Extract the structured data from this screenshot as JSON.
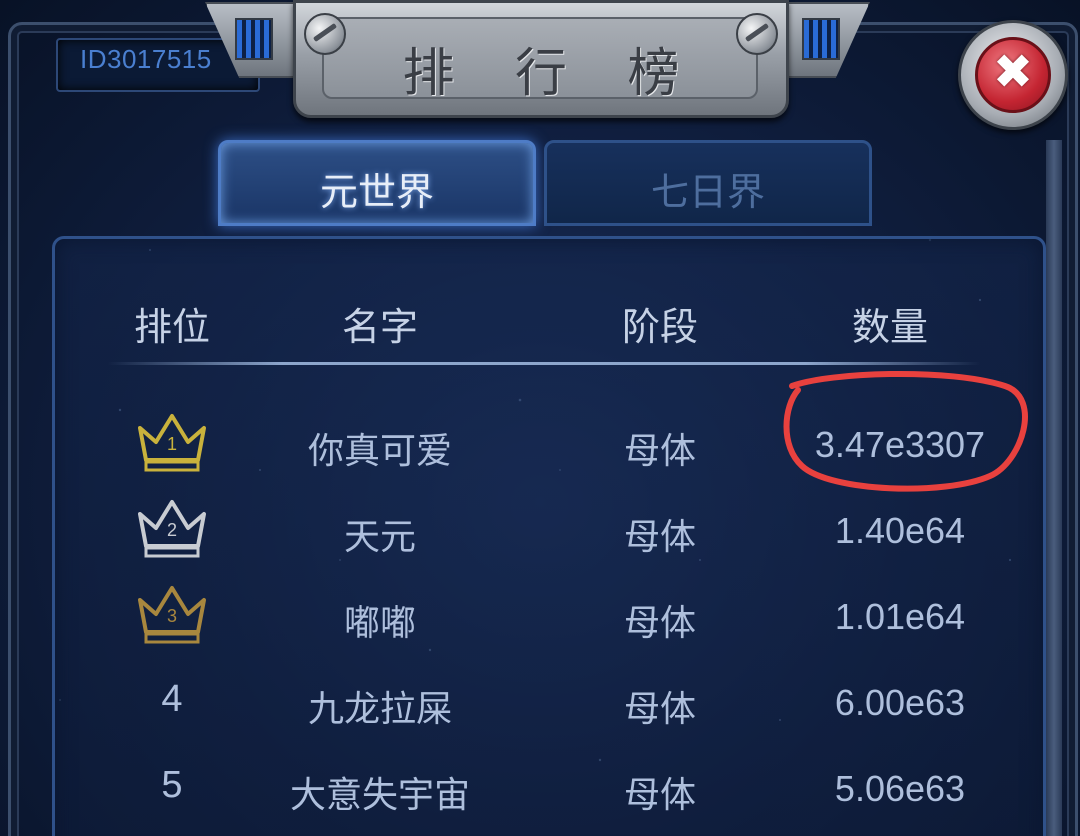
{
  "player_id": "ID3017515",
  "title": "排 行 榜",
  "close_symbol": "✖",
  "tabs": [
    {
      "label": "元世界",
      "active": true
    },
    {
      "label": "七日界",
      "active": false
    }
  ],
  "table": {
    "headers": {
      "rank": "排位",
      "name": "名字",
      "stage": "阶段",
      "amount": "数量"
    },
    "rows": [
      {
        "rank": "1",
        "crown": "gold",
        "name": "你真可爱",
        "stage": "母体",
        "amount": "3.47e3307"
      },
      {
        "rank": "2",
        "crown": "silver",
        "name": "天元",
        "stage": "母体",
        "amount": "1.40e64"
      },
      {
        "rank": "3",
        "crown": "bronze",
        "name": "嘟嘟",
        "stage": "母体",
        "amount": "1.01e64"
      },
      {
        "rank": "4",
        "crown": null,
        "name": "九龙拉屎",
        "stage": "母体",
        "amount": "6.00e63"
      },
      {
        "rank": "5",
        "crown": null,
        "name": "大意失宇宙",
        "stage": "母体",
        "amount": "5.06e63"
      }
    ]
  },
  "icons": {
    "crown": "crown-icon",
    "close": "close-icon",
    "screw": "screw-icon",
    "annotation": "red-circle-annotation"
  },
  "colors": {
    "gold_crown": "#c9b23c",
    "silver_crown": "#c8ccd2",
    "bronze_crown": "#a8873e",
    "annotation": "#e8413e",
    "tab_active_border": "#4e7cc6"
  }
}
